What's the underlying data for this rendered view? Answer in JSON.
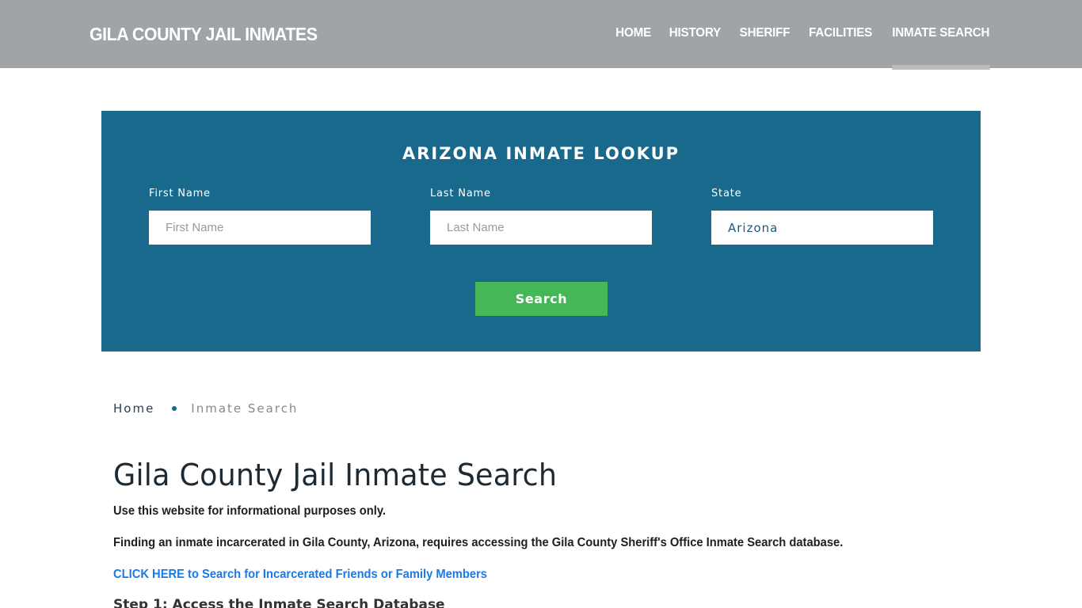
{
  "header": {
    "brand": "GILA COUNTY JAIL INMATES",
    "nav": [
      {
        "label": "HOME",
        "active": false
      },
      {
        "label": "HISTORY",
        "active": false
      },
      {
        "label": "SHERIFF",
        "active": false
      },
      {
        "label": "FACILITIES",
        "active": false
      },
      {
        "label": "INMATE SEARCH",
        "active": true
      }
    ]
  },
  "lookup": {
    "title": "ARIZONA INMATE LOOKUP",
    "fields": {
      "first_name": {
        "label": "First Name",
        "placeholder": "First Name",
        "value": ""
      },
      "last_name": {
        "label": "Last Name",
        "placeholder": "Last Name",
        "value": ""
      },
      "state": {
        "label": "State",
        "value": "Arizona"
      }
    },
    "search_label": "Search",
    "colors": {
      "panel": "#18698c",
      "button": "#45b757"
    }
  },
  "breadcrumb": {
    "home": "Home",
    "current": "Inmate Search"
  },
  "content": {
    "title": "Gila County Jail Inmate Search",
    "paragraphs": [
      "Use this website for informational purposes only.",
      "Finding an inmate incarcerated in Gila County, Arizona, requires accessing the Gila County Sheriff's Office Inmate Search database."
    ],
    "link": "CLICK HERE to Search for Incarcerated Friends or Family Members",
    "step1": "Step 1: Access the Inmate Search Database"
  }
}
